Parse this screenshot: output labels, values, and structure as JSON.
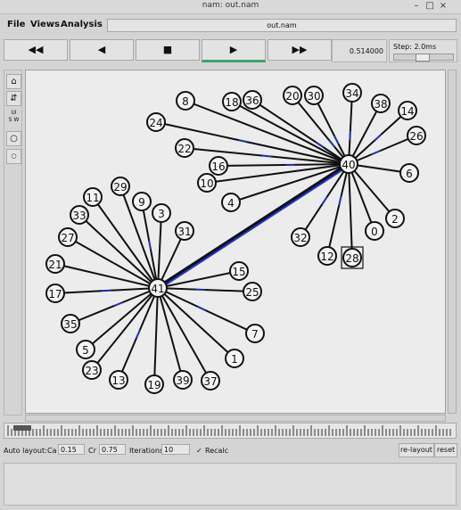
{
  "window": {
    "title": "nam: out.nam",
    "minimize": "–",
    "maximize": "□",
    "close": "×"
  },
  "menu": {
    "file": "File",
    "views": "Views",
    "analysis": "Analysis"
  },
  "file_name": "out.nam",
  "toolbar": {
    "rewind": "◀◀",
    "back": "◀",
    "stop": "■",
    "play": "▶",
    "forward": "▶▶"
  },
  "time_display": "0.514000",
  "step_label": "Step: 2.0ms",
  "left_tools": [
    "home-icon",
    "collapse-icon",
    "scale-icon",
    "circle-icon",
    "small-circle-icon"
  ],
  "left_tool_glyphs": [
    "⌂",
    "⇵",
    "",
    "○",
    "○"
  ],
  "scale_text": "UI\nS W",
  "auto_layout": {
    "label": "Auto layout:",
    "ca_label": "Ca",
    "ca_value": "0.15",
    "cr_label": "Cr",
    "cr_value": "0.75",
    "iterations_label": "Iterations",
    "iterations_value": "10",
    "recalc_label": "Recalc",
    "recalc_checked": true
  },
  "buttons": {
    "relayout": "re-layout",
    "reset": "reset"
  },
  "hubs": [
    {
      "id": "40"
    },
    {
      "id": "41"
    }
  ],
  "nodes": [
    {
      "id": "8",
      "hub": "40"
    },
    {
      "id": "18",
      "hub": "40"
    },
    {
      "id": "36",
      "hub": "40"
    },
    {
      "id": "20",
      "hub": "40"
    },
    {
      "id": "30",
      "hub": "40"
    },
    {
      "id": "34",
      "hub": "40"
    },
    {
      "id": "38",
      "hub": "40"
    },
    {
      "id": "14",
      "hub": "40"
    },
    {
      "id": "26",
      "hub": "40"
    },
    {
      "id": "6",
      "hub": "40"
    },
    {
      "id": "24",
      "hub": "40"
    },
    {
      "id": "22",
      "hub": "40"
    },
    {
      "id": "16",
      "hub": "40"
    },
    {
      "id": "10",
      "hub": "40"
    },
    {
      "id": "4",
      "hub": "40"
    },
    {
      "id": "32",
      "hub": "40"
    },
    {
      "id": "12",
      "hub": "40"
    },
    {
      "id": "28",
      "hub": "40"
    },
    {
      "id": "0",
      "hub": "40"
    },
    {
      "id": "2",
      "hub": "40"
    },
    {
      "id": "11",
      "hub": "41"
    },
    {
      "id": "29",
      "hub": "41"
    },
    {
      "id": "9",
      "hub": "41"
    },
    {
      "id": "3",
      "hub": "41"
    },
    {
      "id": "31",
      "hub": "41"
    },
    {
      "id": "33",
      "hub": "41"
    },
    {
      "id": "27",
      "hub": "41"
    },
    {
      "id": "21",
      "hub": "41"
    },
    {
      "id": "17",
      "hub": "41"
    },
    {
      "id": "35",
      "hub": "41"
    },
    {
      "id": "5",
      "hub": "41"
    },
    {
      "id": "23",
      "hub": "41"
    },
    {
      "id": "13",
      "hub": "41"
    },
    {
      "id": "19",
      "hub": "41"
    },
    {
      "id": "39",
      "hub": "41"
    },
    {
      "id": "37",
      "hub": "41"
    },
    {
      "id": "1",
      "hub": "41"
    },
    {
      "id": "7",
      "hub": "41"
    },
    {
      "id": "25",
      "hub": "41"
    },
    {
      "id": "15",
      "hub": "41"
    }
  ],
  "selected_node": "28",
  "colors": {
    "packet": "#2233dd",
    "link": "#111111",
    "play_indicator": "#3aa56a"
  }
}
